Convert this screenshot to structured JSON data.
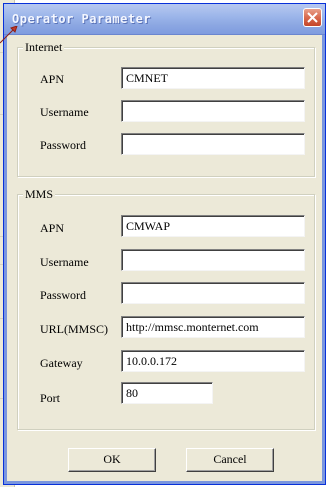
{
  "window": {
    "title": "Operator Parameter"
  },
  "internet": {
    "legend": "Internet",
    "apn": {
      "label": "APN",
      "value": "CMNET"
    },
    "username": {
      "label": "Username",
      "value": ""
    },
    "password": {
      "label": "Password",
      "value": ""
    }
  },
  "mms": {
    "legend": "MMS",
    "apn": {
      "label": "APN",
      "value": "CMWAP"
    },
    "username": {
      "label": "Username",
      "value": ""
    },
    "password": {
      "label": "Password",
      "value": ""
    },
    "url": {
      "label": "URL(MMSC)",
      "value": "http://mmsc.monternet.com"
    },
    "gateway": {
      "label": "Gateway",
      "value": "10.0.0.172"
    },
    "port": {
      "label": "Port",
      "value": "80"
    }
  },
  "buttons": {
    "ok": "OK",
    "cancel": "Cancel"
  },
  "icons": {
    "close": "close-icon",
    "pointer": "arrow-pointer-icon"
  },
  "colors": {
    "titlebar": "#8ca7e2",
    "close_button": "#d86a4e",
    "dialog_face": "#ece9d8"
  }
}
